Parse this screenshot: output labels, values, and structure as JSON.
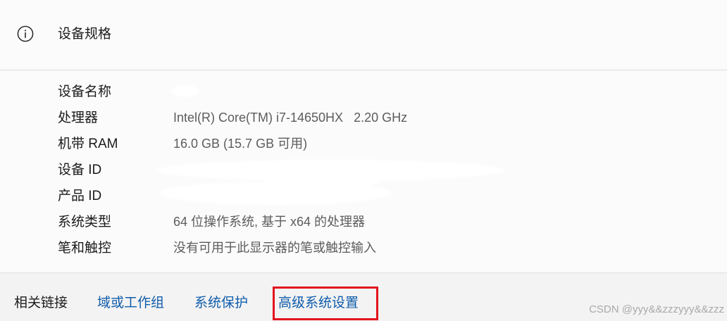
{
  "device_specs": {
    "title": "设备规格",
    "icon": "info-icon",
    "rows": [
      {
        "label": "设备名称",
        "value": ""
      },
      {
        "label": "处理器",
        "value": "Intel(R) Core(TM) i7-14650HX   2.20 GHz"
      },
      {
        "label": "机带 RAM",
        "value": "16.0 GB (15.7 GB 可用)"
      },
      {
        "label": "设备 ID",
        "value": ""
      },
      {
        "label": "产品 ID",
        "value": ""
      },
      {
        "label": "系统类型",
        "value": "64 位操作系统, 基于 x64 的处理器"
      },
      {
        "label": "笔和触控",
        "value": "没有可用于此显示器的笔或触控输入"
      }
    ]
  },
  "related_links": {
    "heading": "相关链接",
    "links": [
      "域或工作组",
      "系统保护",
      "高级系统设置"
    ]
  },
  "watermark": "CSDN @yyy&&zzzyyy&&zzz",
  "colors": {
    "text_primary": "#1b1b1b",
    "text_secondary": "#5c5c5c",
    "link": "#0f5cab",
    "highlight": "#e3141c",
    "card_bg": "#fbfbfb",
    "page_bg": "#f3f3f3"
  }
}
